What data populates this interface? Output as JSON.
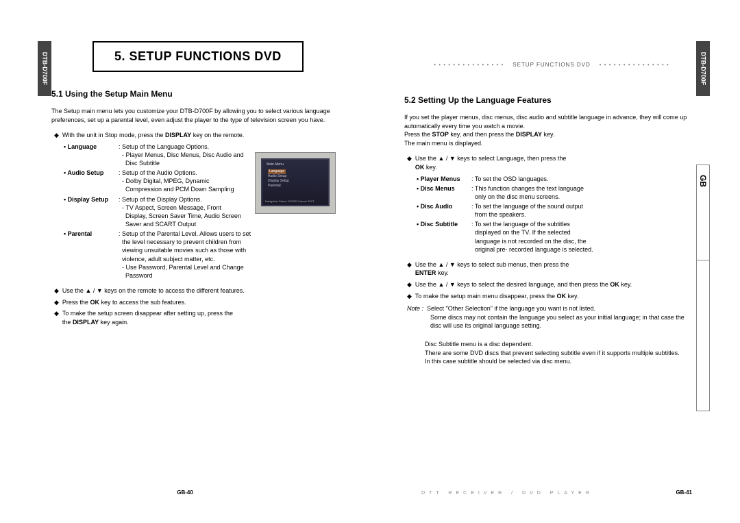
{
  "model": "DTB-D700F",
  "gb": "GB",
  "chapter": "5. SETUP FUNCTIONS DVD",
  "running_header": "SETUP FUNCTIONS DVD",
  "left": {
    "section": "5.1 Using the Setup Main Menu",
    "intro": "The Setup main menu lets you customize your DTB-D700F by allowing you to select various language preferences, set up a parental level, even adjust the player to the type of television screen you have.",
    "b1_pre": "With the unit in Stop mode, press the ",
    "b1_key": "DISPLAY",
    "b1_post": " key on the remote.",
    "opts": [
      {
        "label": "• Language",
        "desc": ": Setup of the Language Options.<br>&nbsp;&nbsp;- Player Menus, Disc Menus, Disc Audio and<br>&nbsp;&nbsp;&nbsp;&nbsp;Disc Subtitle"
      },
      {
        "label": "• Audio Setup",
        "desc": ": Setup of the Audio Options.<br>&nbsp;&nbsp;- Dolby Digital, MPEG, Dynamic<br>&nbsp;&nbsp;&nbsp;&nbsp;Compression and PCM Down Sampling"
      },
      {
        "label": "• Display Setup",
        "desc": ": Setup of the Display Options.<br>&nbsp;&nbsp;- TV Aspect, Screen Message, Front<br>&nbsp;&nbsp;&nbsp;&nbsp;Display, Screen Saver Time, Audio Screen<br>&nbsp;&nbsp;&nbsp;&nbsp;Saver and SCART Output"
      },
      {
        "label": "• Parental",
        "desc": ": Setup of the Parental Level. Allows users to set<br>&nbsp;&nbsp;the level necessary to prevent children from<br>&nbsp;&nbsp;viewing unsuitable movies such as those with<br>&nbsp;&nbsp;violence, adult subject matter, etc.<br>&nbsp;&nbsp;- Use Password, Parental Level and Change<br>&nbsp;&nbsp;&nbsp;&nbsp;Password"
      }
    ],
    "b2": "Use the ▲ / ▼ keys on the remote to access the different features.",
    "b3_pre": "Press the ",
    "b3_key": "OK",
    "b3_post": " key to access the sub features.",
    "b4_pre": "To make the setup screen disappear after setting up, press the ",
    "b4_key": "DISPLAY",
    "b4_post": " key again.",
    "page_num": "GB-40",
    "ss": {
      "title": "Main Menu",
      "m1": "Language",
      "m2": "Audio Setup",
      "m3": "Display Setup",
      "m4": "Parental",
      "hint": "Navigation Select: ENTER Cancel: EXIT"
    }
  },
  "right": {
    "section": "5.2 Setting Up the Language Features",
    "intro1": "If you set the player menus, disc menus, disc audio and subtitle language in advance, they will come up automatically every time you watch a movie.",
    "intro2_pre": "Press the ",
    "intro2_k1": "STOP",
    "intro2_mid": " key, and then press the ",
    "intro2_k2": "DISPLAY",
    "intro2_post": " key.",
    "intro3": "The main menu is displayed.",
    "b1_pre": "Use the ▲ / ▼ keys to select Language, then press the ",
    "b1_key": "OK",
    "b1_post": " key.",
    "opts": [
      {
        "label": "• Player Menus",
        "desc": ": To set the OSD languages."
      },
      {
        "label": "• Disc Menus",
        "desc": ": This function changes the text language<br>&nbsp;&nbsp;only on the disc menu screens."
      },
      {
        "label": "• Disc Audio",
        "desc": ": To set the language of the sound output<br>&nbsp;&nbsp;from the speakers."
      },
      {
        "label": "• Disc Subtitle",
        "desc": ": To set the language of the subtitles<br>&nbsp;&nbsp;displayed  on the TV. If the selected<br>&nbsp;&nbsp;language is not recorded on the disc, the<br>&nbsp;&nbsp;original pre- recorded language is selected."
      }
    ],
    "b2_pre": "Use the ▲ / ▼ keys to select sub menus, then press the ",
    "b2_key": "ENTER",
    "b2_post": " key.",
    "b3_pre": "Use the ▲ / ▼ keys to select the desired language, and then press the ",
    "b3_key": "OK",
    "b3_post": " key.",
    "b4_pre": "To make the setup main menu disappear, press the ",
    "b4_key": "OK",
    "b4_post": " key.",
    "note_label": "Note :",
    "note1": "Select \"Other Selection\" if the language you want is not listed.",
    "note2": "Some discs may not contain the language you select as your initial language; in that case the disc will use its original language setting.",
    "trail1": "Disc Subtitle menu is a disc dependent.",
    "trail2": "There are some DVD discs that prevent selecting subtitle even if it supports multiple subtitles.",
    "trail3": "In this case subtitle should be selected via disc menu.",
    "footer_spacer": "DTT RECEIVER / DVD PLAYER",
    "page_num": "GB-41"
  }
}
